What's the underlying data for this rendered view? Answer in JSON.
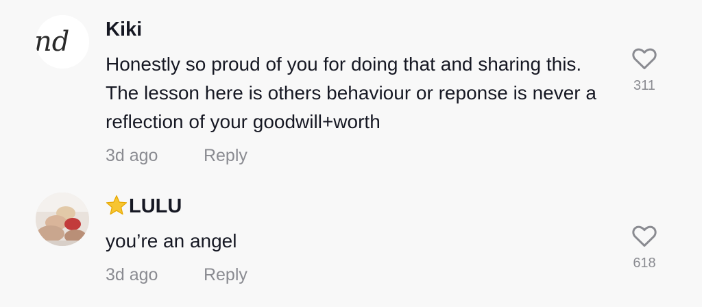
{
  "comments": [
    {
      "username": "Kiki",
      "avatar_text": "nd",
      "text": "Honestly so proud of you for doing that and sharing this. The lesson here is others behaviour or reponse is never a reflection of your goodwill+worth",
      "time": "3d ago",
      "reply_label": "Reply",
      "likes": "311",
      "like_icon": "heart-outline-icon"
    },
    {
      "username": "LULU",
      "username_prefix_icon": "star-emoji-icon",
      "text": "you’re an angel",
      "time": "3d ago",
      "reply_label": "Reply",
      "likes": "618",
      "like_icon": "heart-outline-icon"
    }
  ],
  "colors": {
    "background": "#f8f8f8",
    "primary_text": "#161823",
    "secondary_text": "#8a8b91",
    "star": "#f7c531"
  }
}
